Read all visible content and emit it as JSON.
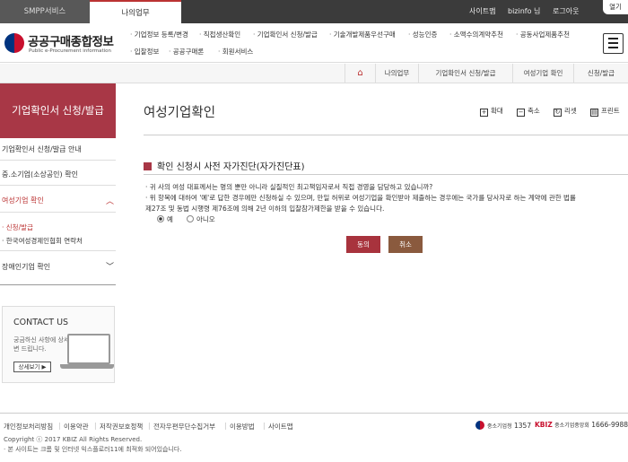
{
  "topbar": {
    "tabs": [
      "SMPP서비스",
      "나의업무"
    ],
    "util_links": [
      "사이트맵",
      "bizinfo 님",
      "로그아웃"
    ],
    "open_label": "열기"
  },
  "header": {
    "logo_title": "공공구매종합정보",
    "logo_sub": "Public e-Procurement information",
    "menu": [
      "기업정보 등록/변경",
      "직접생산확인",
      "기업확인서 신청/발급",
      "기술개발제품우선구매",
      "성능인증",
      "소액수의계약추천",
      "공동사업제품추천",
      "입찰정보",
      "공공구매론",
      "회원서비스"
    ]
  },
  "breadcrumb": {
    "home_icon": "home-icon",
    "items": [
      "나의업무",
      "기업확인서 신청/발급",
      "여성기업 확인",
      "신청/발급"
    ]
  },
  "sidebar": {
    "title": "기업확인서 신청/발급",
    "items": [
      "기업확인서 신청/발급 안내",
      "중.소기업(소상공인) 확인",
      "여성기업 확인"
    ],
    "sub_items": [
      "· 신청/발급",
      "· 한국여성경제인협회 연락처"
    ],
    "extra_item": "장애인기업 확인",
    "contact": {
      "title": "CONTACT US",
      "desc": "궁금하신 사항에 상세히 답변 드립니다.",
      "button": "상세보기 ▶"
    }
  },
  "content": {
    "title": "여성기업확인",
    "tools": [
      "확대",
      "축소",
      "리셋",
      "프린트"
    ],
    "section_title": "확인 신청시 사전 자가진단(자가진단표)",
    "questions": [
      "· 귀 사의 여성 대표께서는 명의 뿐만 아니라 실질적인 최고책임자로서 직접 경영을 담당하고 있습니까?",
      "· 위 항목에 대하여 '예'로 답한 경우에만 신청하실 수 있으며, 만일 허위로 여성기업을 확인받아 제출하는 경우에는 국가를 당사자로 하는 계약에 관한 법률",
      "  제27조 및 동법 시행령 제76조에 의해 2년 이하의 입찰참가제한을 받을 수 있습니다."
    ],
    "radio_yes": "예",
    "radio_no": "아니오",
    "btn_agree": "동의",
    "btn_cancel": "취소"
  },
  "footer": {
    "links": [
      "개인정보처리방침",
      "이용약관",
      "저작권보호정책",
      "전자우편무단수집거부",
      "이용방법",
      "사이트맵"
    ],
    "copyright": "Copyright ⓒ 2017 KBIZ All Rights Reserved.",
    "notice": "· 본 사이트는 크롬 및 인터넷 익스플로러11에 최적화 되어있습니다.",
    "call1_label": "중소기업청",
    "call1_num": "1357",
    "call2_label": "KBIZ",
    "call2_sub": "중소기업중앙회",
    "call2_num": "1666-9988"
  },
  "colors": {
    "accent": "#a83746",
    "topbar": "#3b3b3b",
    "cancel": "#8a5a3e"
  }
}
